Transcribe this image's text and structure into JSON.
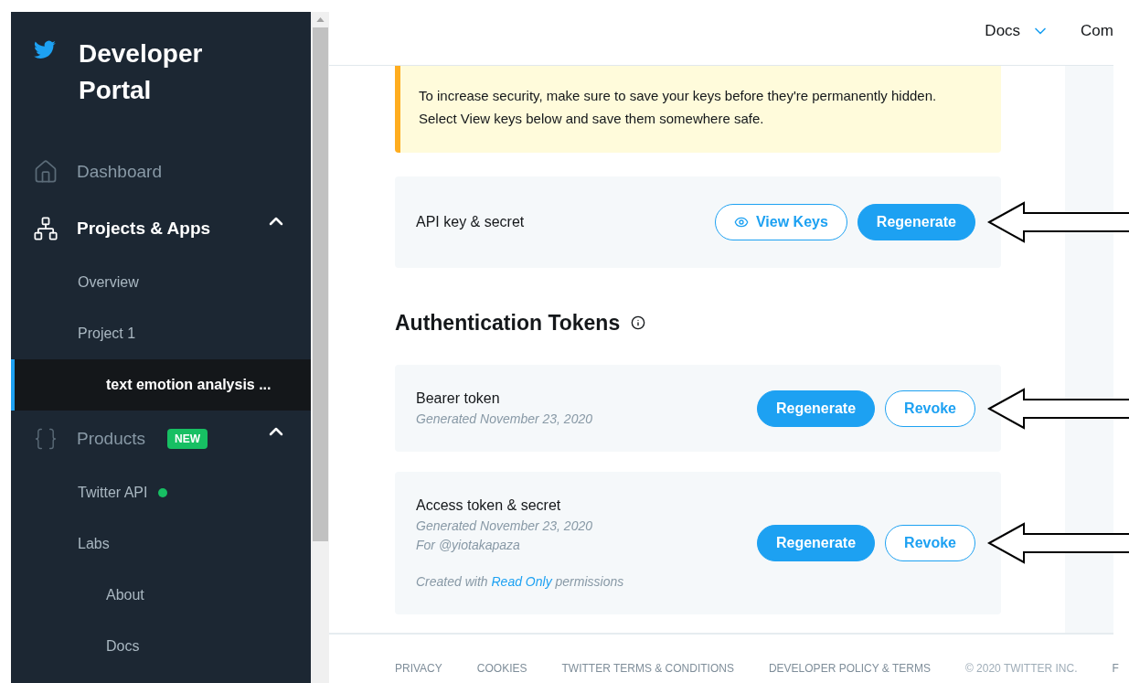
{
  "sidebar": {
    "brand": "Developer Portal",
    "sections": [
      {
        "kind": "link",
        "label": "Dashboard"
      },
      {
        "kind": "group",
        "label": "Projects & Apps",
        "expanded": true,
        "children": [
          {
            "label": "Overview",
            "selected": false
          },
          {
            "label": "Project 1",
            "selected": false,
            "children": [
              {
                "label": "text emotion analysis ...",
                "selected": true
              }
            ]
          }
        ]
      },
      {
        "kind": "group",
        "label": "Products",
        "badge": "NEW",
        "expanded": true,
        "children": [
          {
            "label": "Twitter API",
            "selected": false,
            "color": "#17bf63"
          },
          {
            "label": "Labs",
            "selected": false,
            "children": [
              {
                "label": "About",
                "selected": false
              },
              {
                "label": "Docs",
                "selected": false
              }
            ]
          }
        ]
      }
    ]
  },
  "header": {
    "nav": [
      {
        "label": "Docs",
        "dropdown": true
      },
      {
        "label": "Com",
        "dropdown": false
      }
    ]
  },
  "notice": "To increase security, make sure to save your keys before they're permanently hidden. Select View keys below and save them somewhere safe.",
  "api_card": {
    "title": "API key & secret",
    "buttons": [
      {
        "label": "View Keys",
        "kind": "outline"
      },
      {
        "label": "Regenerate",
        "kind": "primary"
      }
    ]
  },
  "tokens": {
    "heading": "Authentication Tokens",
    "cards": [
      {
        "title": "Bearer token",
        "meta": [
          "Generated November 23, 2020"
        ],
        "buttons": [
          {
            "label": "Regenerate",
            "kind": "primary"
          },
          {
            "label": "Revoke",
            "kind": "outline"
          }
        ]
      },
      {
        "title": "Access token & secret",
        "meta": [
          "Generated November 23, 2020",
          "For @yiotakapaza"
        ],
        "note": {
          "prefix": "Created with",
          "link": "Read Only",
          "suffix": "permissions"
        },
        "buttons": [
          {
            "label": "Regenerate",
            "kind": "primary"
          },
          {
            "label": "Revoke",
            "kind": "outline"
          }
        ]
      }
    ]
  },
  "footer": [
    {
      "label": "PRIVACY",
      "muted": false
    },
    {
      "label": "COOKIES",
      "muted": false
    },
    {
      "label": "TWITTER TERMS & CONDITIONS",
      "muted": false
    },
    {
      "label": "DEVELOPER POLICY & TERMS",
      "muted": false
    },
    {
      "label": "© 2020 TWITTER INC.",
      "muted": true
    },
    {
      "label": "F",
      "muted": false
    }
  ]
}
